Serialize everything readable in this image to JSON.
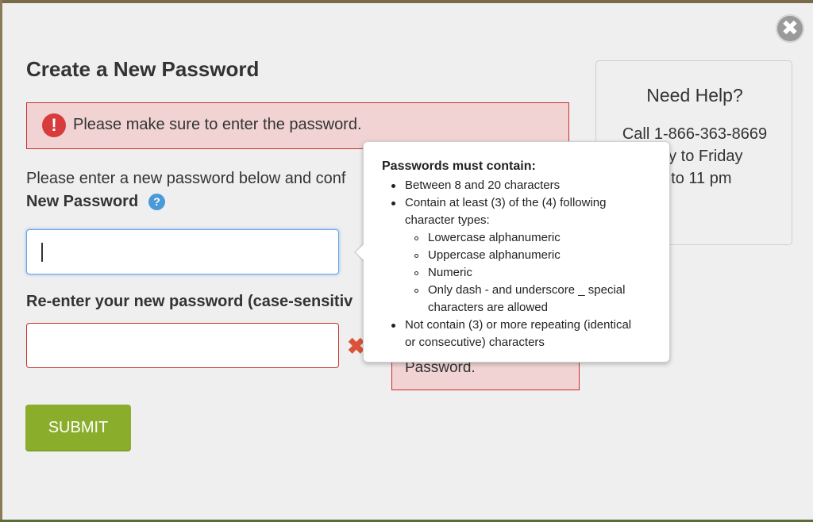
{
  "dialog": {
    "title": "Create a New Password",
    "close_label": "✖"
  },
  "error_banner": {
    "icon": "!",
    "message": "Please make sure to enter the password."
  },
  "form": {
    "intro": "Please enter a new password below and conf",
    "new_password_label": "New Password",
    "help_icon": "?",
    "new_password_value": "",
    "reenter_label": "Re-enter your new password (case-sensitiv",
    "reenter_value": "",
    "mismatch_mark": "✖",
    "reenter_error": "Password.",
    "submit_label": "SUBMIT"
  },
  "help_box": {
    "title": "Need Help?",
    "lines": [
      "Call 1-866-363-8669",
      "lay to Friday",
      "n to 11 pm"
    ]
  },
  "tooltip": {
    "heading": "Passwords must contain:",
    "items": [
      "Between 8 and 20 characters",
      "Contain at least (3) of the (4) following",
      "character types:",
      "Lowercase alphanumeric",
      "Uppercase alphanumeric",
      "Numeric",
      "Only dash - and underscore _ special",
      "characters are allowed",
      "Not contain (3) or more repeating (identical",
      "or consecutive) characters"
    ]
  },
  "colors": {
    "error_red": "#c9302c",
    "submit_green": "#8aad2c",
    "help_blue": "#4a9ad8"
  }
}
